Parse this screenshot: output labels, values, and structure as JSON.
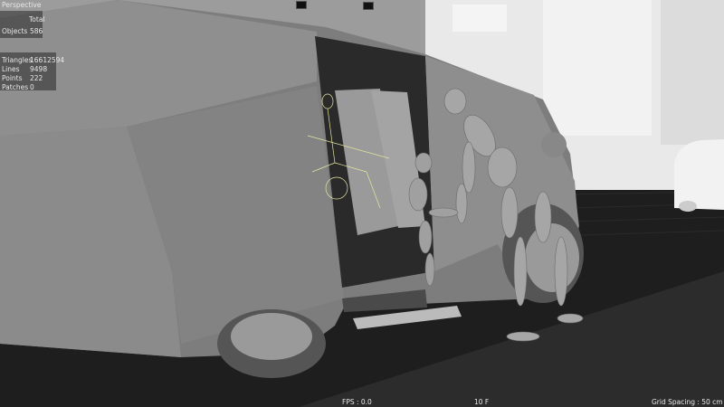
{
  "viewport": {
    "view_name": "Perspective",
    "stats_header": "Total",
    "objects_label": "Objects",
    "objects_value": "586",
    "triangles_label": "Triangles",
    "triangles_value": "16612594",
    "lines_label": "Lines",
    "lines_value": "9498",
    "points_label": "Points",
    "points_value": "222",
    "patches_label": "Patches",
    "patches_value": "0"
  },
  "status_bar": {
    "fps": "FPS : 0.0",
    "frame": "10 F",
    "grid_spacing": "Grid Spacing : 50 cm"
  },
  "icons": [
    "camera-icon",
    "render-icon"
  ],
  "colors": {
    "background_floor": "#1e1e1e",
    "van_body": "#8a8a8a",
    "buildings": "#e6e6e6",
    "hud_text": "#e8e8e8"
  }
}
